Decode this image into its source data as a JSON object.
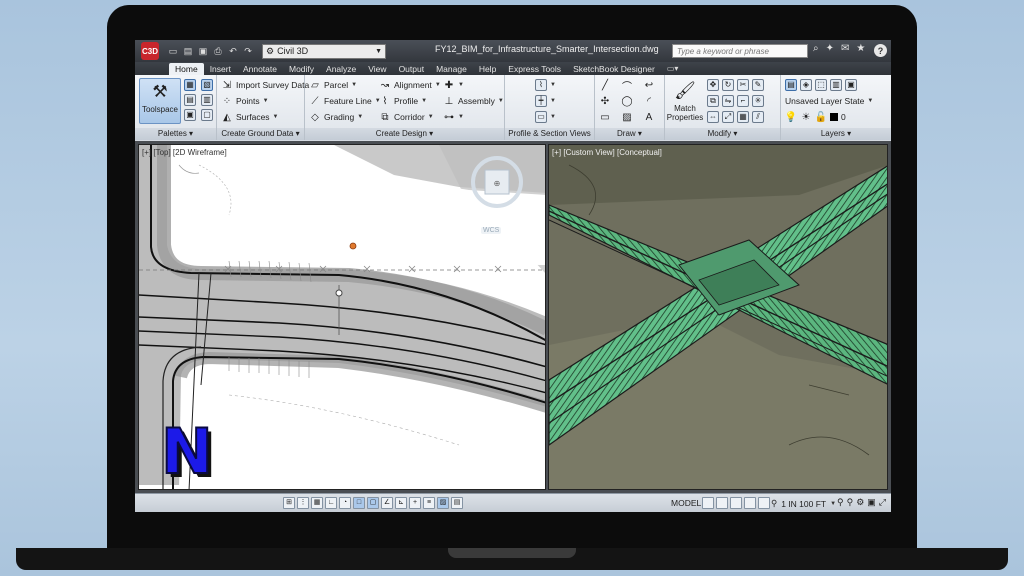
{
  "app": {
    "logo_text": "C3D",
    "workspace": "Civil 3D",
    "document_title": "FY12_BIM_for_Infrastructure_Smarter_Intersection.dwg",
    "search_placeholder": "Type a keyword or phrase",
    "help": "?"
  },
  "tabs": [
    "Home",
    "Insert",
    "Annotate",
    "Modify",
    "Analyze",
    "View",
    "Output",
    "Manage",
    "Help",
    "Express Tools",
    "SketchBook Designer"
  ],
  "active_tab": "Home",
  "ribbon": {
    "palettes": {
      "toolspace": "Toolspace",
      "footer": "Palettes"
    },
    "create_ground_data": {
      "import_survey": "Import Survey Data",
      "points": "Points",
      "surfaces": "Surfaces",
      "footer": "Create Ground Data"
    },
    "create_design": {
      "parcel": "Parcel",
      "feature_line": "Feature Line",
      "grading": "Grading",
      "alignment": "Alignment",
      "profile": "Profile",
      "corridor": "Corridor",
      "assembly": "Assembly",
      "footer": "Create Design"
    },
    "profile_section": {
      "footer": "Profile & Section Views"
    },
    "draw": {
      "footer": "Draw"
    },
    "modify": {
      "match_line1": "Match",
      "match_line2": "Properties",
      "footer": "Modify"
    },
    "layers": {
      "layer_state": "Unsaved Layer State",
      "current_layer": "0",
      "footer": "Layers"
    }
  },
  "viewports": {
    "left_label": "[+] [Top] [2D Wireframe]",
    "right_label": "[+] [Custom View] [Conceptual]",
    "wcs": "WCS"
  },
  "watermark_letter": "N",
  "statusbar": {
    "model": "MODEL",
    "scale": "1 IN 100 FT"
  }
}
